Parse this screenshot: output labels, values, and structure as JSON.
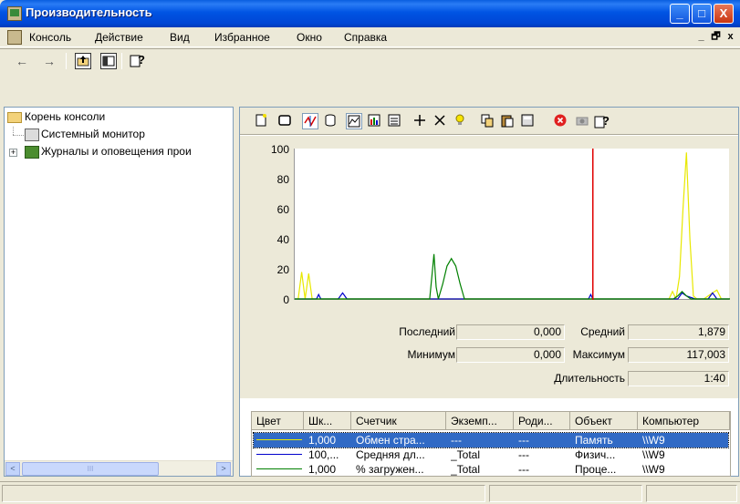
{
  "window": {
    "title": "Производительность",
    "controls": {
      "minimize": "_",
      "maximize": "□",
      "close": "X"
    }
  },
  "menu": {
    "items": [
      {
        "label": "Консоль"
      },
      {
        "label": "Действие"
      },
      {
        "label": "Вид"
      },
      {
        "label": "Избранное"
      },
      {
        "label": "Окно"
      },
      {
        "label": "Справка"
      }
    ],
    "mdi": {
      "minimize": "_",
      "restore": "🗗",
      "close": "x"
    }
  },
  "toolbar": {
    "back": "←",
    "forward": "→",
    "icons": [
      "up-one-level-icon",
      "show-hide-tree-icon",
      "help-icon"
    ]
  },
  "tree": {
    "root": "Корень консоли",
    "items": [
      {
        "label": "Системный монитор",
        "icon": "system-monitor-icon"
      },
      {
        "label": "Журналы и оповещения прои",
        "icon": "logs-alerts-icon",
        "expander": "+"
      }
    ],
    "scroll": {
      "left": "<",
      "right": ">",
      "grip": "III"
    }
  },
  "chart_data": {
    "type": "line",
    "ylim": [
      0,
      100
    ],
    "yticks": [
      100,
      80,
      60,
      40,
      20,
      0
    ],
    "x_range": [
      0,
      100
    ],
    "cursor_x": 68.5,
    "series": [
      {
        "color": "#e8e800",
        "x": [
          0,
          0.8,
          1.6,
          2.4,
          3.2,
          4.0,
          4.8,
          5.6,
          6.4,
          20,
          21,
          22,
          30,
          40,
          50,
          60,
          67,
          68,
          69,
          70,
          80,
          86,
          86.8,
          87.6,
          88.4,
          89.2,
          90.0,
          90.8,
          91.6,
          92.4,
          94,
          96,
          97,
          98,
          100
        ],
        "y": [
          0,
          0,
          18,
          0,
          17,
          0,
          0,
          0,
          0,
          0,
          0,
          0,
          0,
          0,
          0,
          0,
          0,
          0,
          0,
          0,
          0,
          0,
          5,
          0,
          15,
          60,
          98,
          40,
          2,
          0,
          0,
          4,
          6,
          0,
          0
        ]
      },
      {
        "color": "#0000cc",
        "x": [
          0,
          5,
          5.5,
          6,
          10,
          11,
          12,
          20,
          60,
          67.5,
          68,
          68.5,
          70,
          85,
          88,
          89,
          90,
          92,
          95,
          96,
          97,
          100
        ],
        "y": [
          0,
          0,
          3,
          0,
          0,
          4,
          0,
          0,
          0,
          0,
          3,
          0,
          0,
          0,
          0,
          4,
          2,
          0,
          0,
          4,
          0,
          0
        ]
      },
      {
        "color": "#008000",
        "x": [
          0,
          30,
          31,
          31.5,
          32,
          32.5,
          33,
          34,
          35,
          36,
          37,
          38,
          39,
          40,
          60,
          80,
          87,
          88,
          89,
          90,
          91,
          92,
          100
        ],
        "y": [
          0,
          0,
          0,
          15,
          30,
          8,
          0,
          10,
          22,
          27,
          22,
          10,
          0,
          0,
          0,
          0,
          0,
          2,
          5,
          2,
          0,
          0,
          0
        ]
      }
    ]
  },
  "stats": {
    "last_label": "Последний",
    "last_value": "0,000",
    "avg_label": "Средний",
    "avg_value": "1,879",
    "min_label": "Минимум",
    "min_value": "0,000",
    "max_label": "Максимум",
    "max_value": "117,003",
    "dur_label": "Длительность",
    "dur_value": "1:40"
  },
  "legend": {
    "columns": [
      "Цвет",
      "Шк...",
      "Счетчик",
      "Экземп...",
      "Роди...",
      "Объект",
      "Компьютер"
    ],
    "rows": [
      {
        "color": "#e8e800",
        "scale": "1,000",
        "counter": "Обмен стра...",
        "instance": "---",
        "parent": "---",
        "object": "Память",
        "computer": "\\\\W9",
        "selected": true
      },
      {
        "color": "#0000cc",
        "scale": "100,...",
        "counter": "Средняя дл...",
        "instance": "_Total",
        "parent": "---",
        "object": "Физич...",
        "computer": "\\\\W9",
        "selected": false
      },
      {
        "color": "#008000",
        "scale": "1,000",
        "counter": "% загружен...",
        "instance": "_Total",
        "parent": "---",
        "object": "Проце...",
        "computer": "\\\\W9",
        "selected": false
      }
    ]
  }
}
